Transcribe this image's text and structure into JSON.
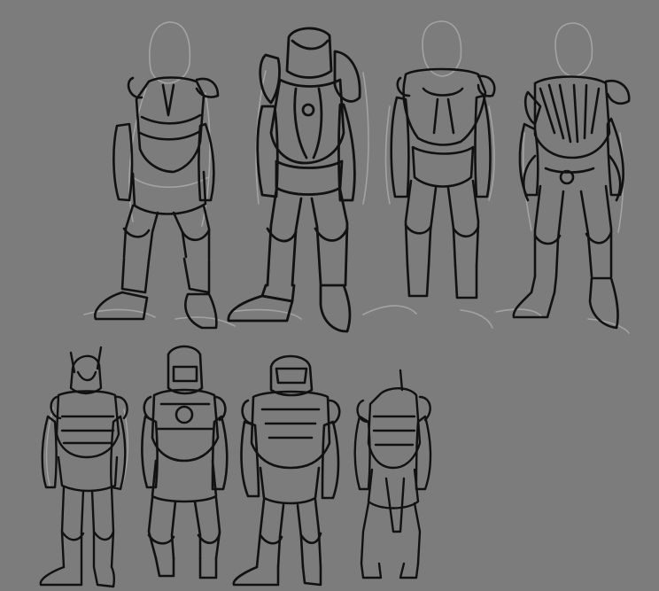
{
  "colors": {
    "background": "#7c7c7c",
    "ink": "#111111",
    "guide": "#a3a3a3"
  },
  "figures": [
    {
      "name": "armor-sketch-1"
    },
    {
      "name": "armor-sketch-2"
    },
    {
      "name": "armor-sketch-3"
    },
    {
      "name": "armor-sketch-4"
    },
    {
      "name": "armor-sketch-5"
    },
    {
      "name": "armor-sketch-6"
    },
    {
      "name": "armor-sketch-7"
    },
    {
      "name": "armor-sketch-8"
    }
  ]
}
